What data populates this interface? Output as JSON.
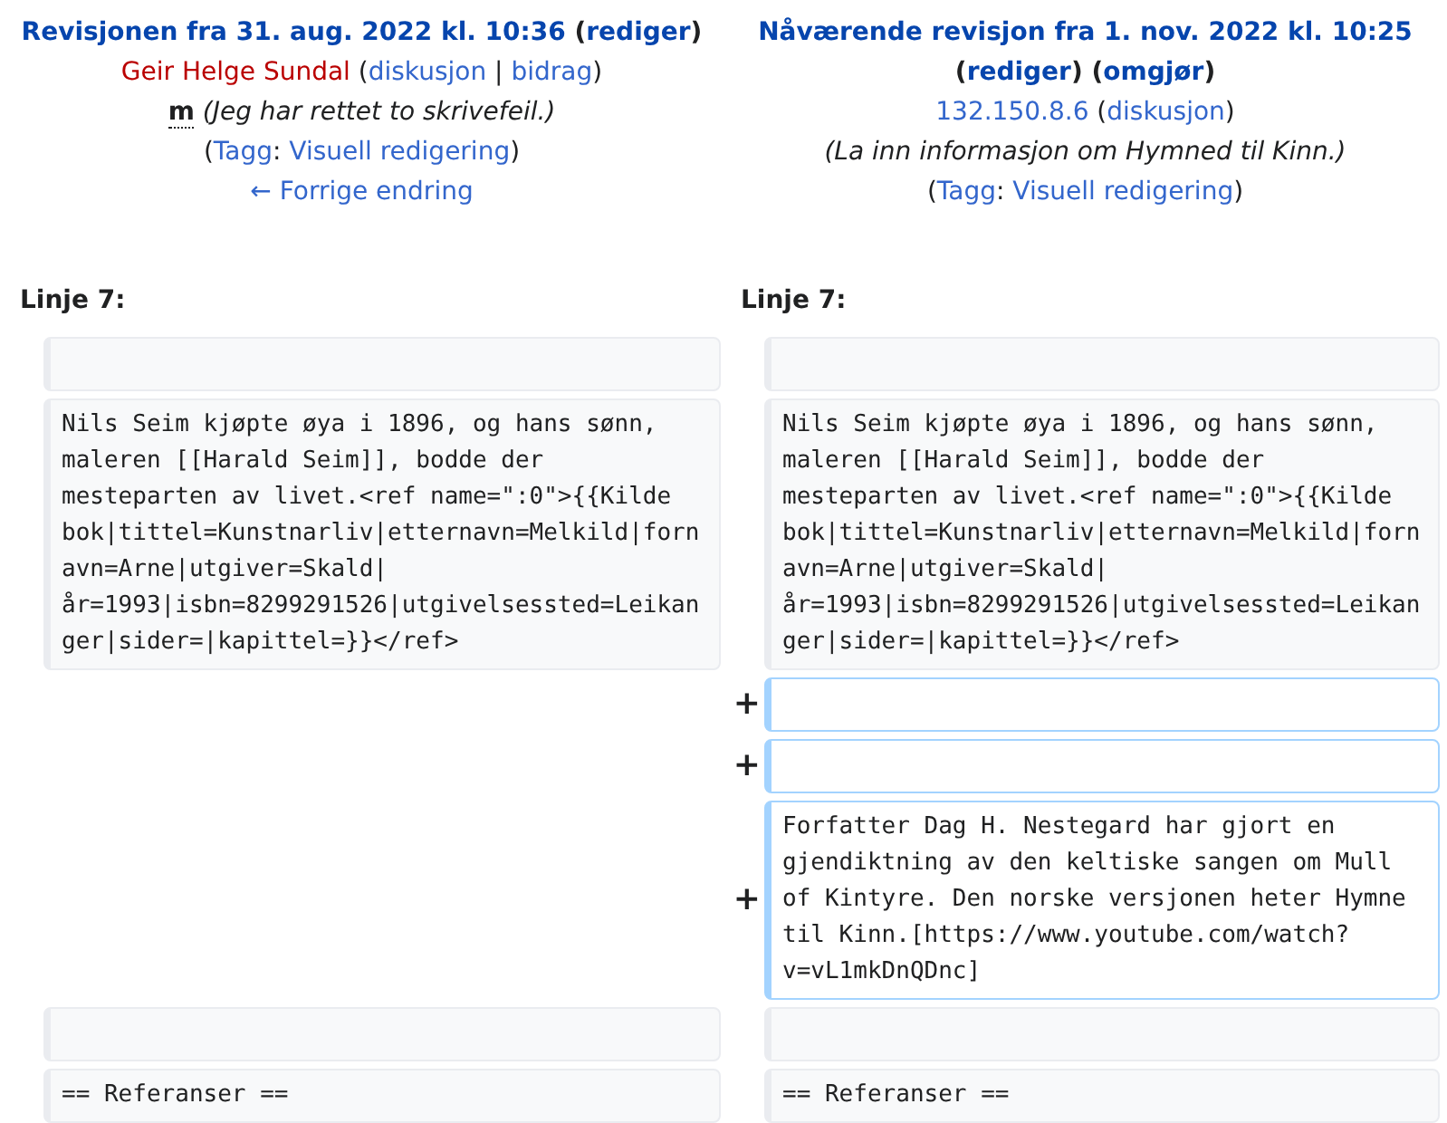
{
  "revisions": [
    {
      "lines": [
        {
          "kind": "title",
          "segments": [
            {
              "kind": "link",
              "text": "Revisjonen fra 31. aug. 2022 kl. 10:36"
            },
            {
              "kind": "text",
              "text": " ("
            },
            {
              "kind": "link",
              "text": "rediger"
            },
            {
              "kind": "text",
              "text": ")"
            }
          ]
        },
        {
          "kind": "user",
          "segments": [
            {
              "kind": "redlink",
              "text": "Geir Helge Sundal"
            },
            {
              "kind": "text",
              "text": " ("
            },
            {
              "kind": "link",
              "text": "diskusjon"
            },
            {
              "kind": "text",
              "text": " | "
            },
            {
              "kind": "link",
              "text": "bidrag"
            },
            {
              "kind": "text",
              "text": ")"
            }
          ]
        },
        {
          "kind": "summary",
          "segments": [
            {
              "kind": "abbr",
              "text": "m"
            },
            {
              "kind": "italic",
              "text": " (Jeg har rettet to skrivefeil.)"
            }
          ]
        },
        {
          "kind": "tags",
          "segments": [
            {
              "kind": "text",
              "text": "("
            },
            {
              "kind": "link",
              "text": "Tagg"
            },
            {
              "kind": "text",
              "text": ": "
            },
            {
              "kind": "link",
              "text": "Visuell redigering"
            },
            {
              "kind": "text",
              "text": ")"
            }
          ]
        },
        {
          "kind": "nav",
          "segments": [
            {
              "kind": "link",
              "text": "← Forrige endring"
            }
          ]
        }
      ]
    },
    {
      "lines": [
        {
          "kind": "title",
          "segments": [
            {
              "kind": "link",
              "text": "Nåværende revisjon fra 1. nov. 2022 kl. 10:25"
            },
            {
              "kind": "text",
              "text": " ("
            },
            {
              "kind": "link",
              "text": "rediger"
            },
            {
              "kind": "text",
              "text": ") ("
            },
            {
              "kind": "link",
              "text": "omgjør"
            },
            {
              "kind": "text",
              "text": ")"
            }
          ]
        },
        {
          "kind": "user",
          "segments": [
            {
              "kind": "link",
              "text": "132.150.8.6"
            },
            {
              "kind": "text",
              "text": " ("
            },
            {
              "kind": "link",
              "text": "diskusjon"
            },
            {
              "kind": "text",
              "text": ")"
            }
          ]
        },
        {
          "kind": "summary",
          "segments": [
            {
              "kind": "italic",
              "text": "(La inn informasjon om Hymned til Kinn.)"
            }
          ]
        },
        {
          "kind": "tags",
          "segments": [
            {
              "kind": "text",
              "text": "("
            },
            {
              "kind": "link",
              "text": "Tagg"
            },
            {
              "kind": "text",
              "text": ": "
            },
            {
              "kind": "link",
              "text": "Visuell redigering"
            },
            {
              "kind": "text",
              "text": ")"
            }
          ]
        }
      ]
    }
  ],
  "diff": {
    "line_headers": [
      "Linje 7:",
      "Linje 7:"
    ],
    "rows": [
      {
        "kind": "context"
      },
      {
        "kind": "context",
        "left": "Nils Seim kjøpte øya i 1896, og hans sønn, maleren [[Harald Seim]], bodde der mesteparten av livet.<ref name=\":0\">{{Kilde bok|tittel=Kunstnarliv|etternavn=Melkild|fornavn=Arne|utgiver=Skald|år=1993|isbn=8299291526|utgivelsessted=Leikanger|sider=|kapittel=}}</ref>",
        "right": "Nils Seim kjøpte øya i 1896, og hans sønn, maleren [[Harald Seim]], bodde der mesteparten av livet.<ref name=\":0\">{{Kilde bok|tittel=Kunstnarliv|etternavn=Melkild|fornavn=Arne|utgiver=Skald|år=1993|isbn=8299291526|utgivelsessted=Leikanger|sider=|kapittel=}}</ref>"
      },
      {
        "kind": "added",
        "marker": "+"
      },
      {
        "kind": "added",
        "marker": "+"
      },
      {
        "kind": "added",
        "marker": "+",
        "right": "Forfatter Dag H. Nestegard har gjort en gjendiktning av den keltiske sangen om Mull of Kintyre. Den norske versjonen heter Hymne til Kinn.[https://www.youtube.com/watch?v=vL1mkDnQDnc]"
      },
      {
        "kind": "context"
      },
      {
        "kind": "context",
        "left": "== Referanser ==",
        "right": "== Referanser =="
      }
    ]
  }
}
